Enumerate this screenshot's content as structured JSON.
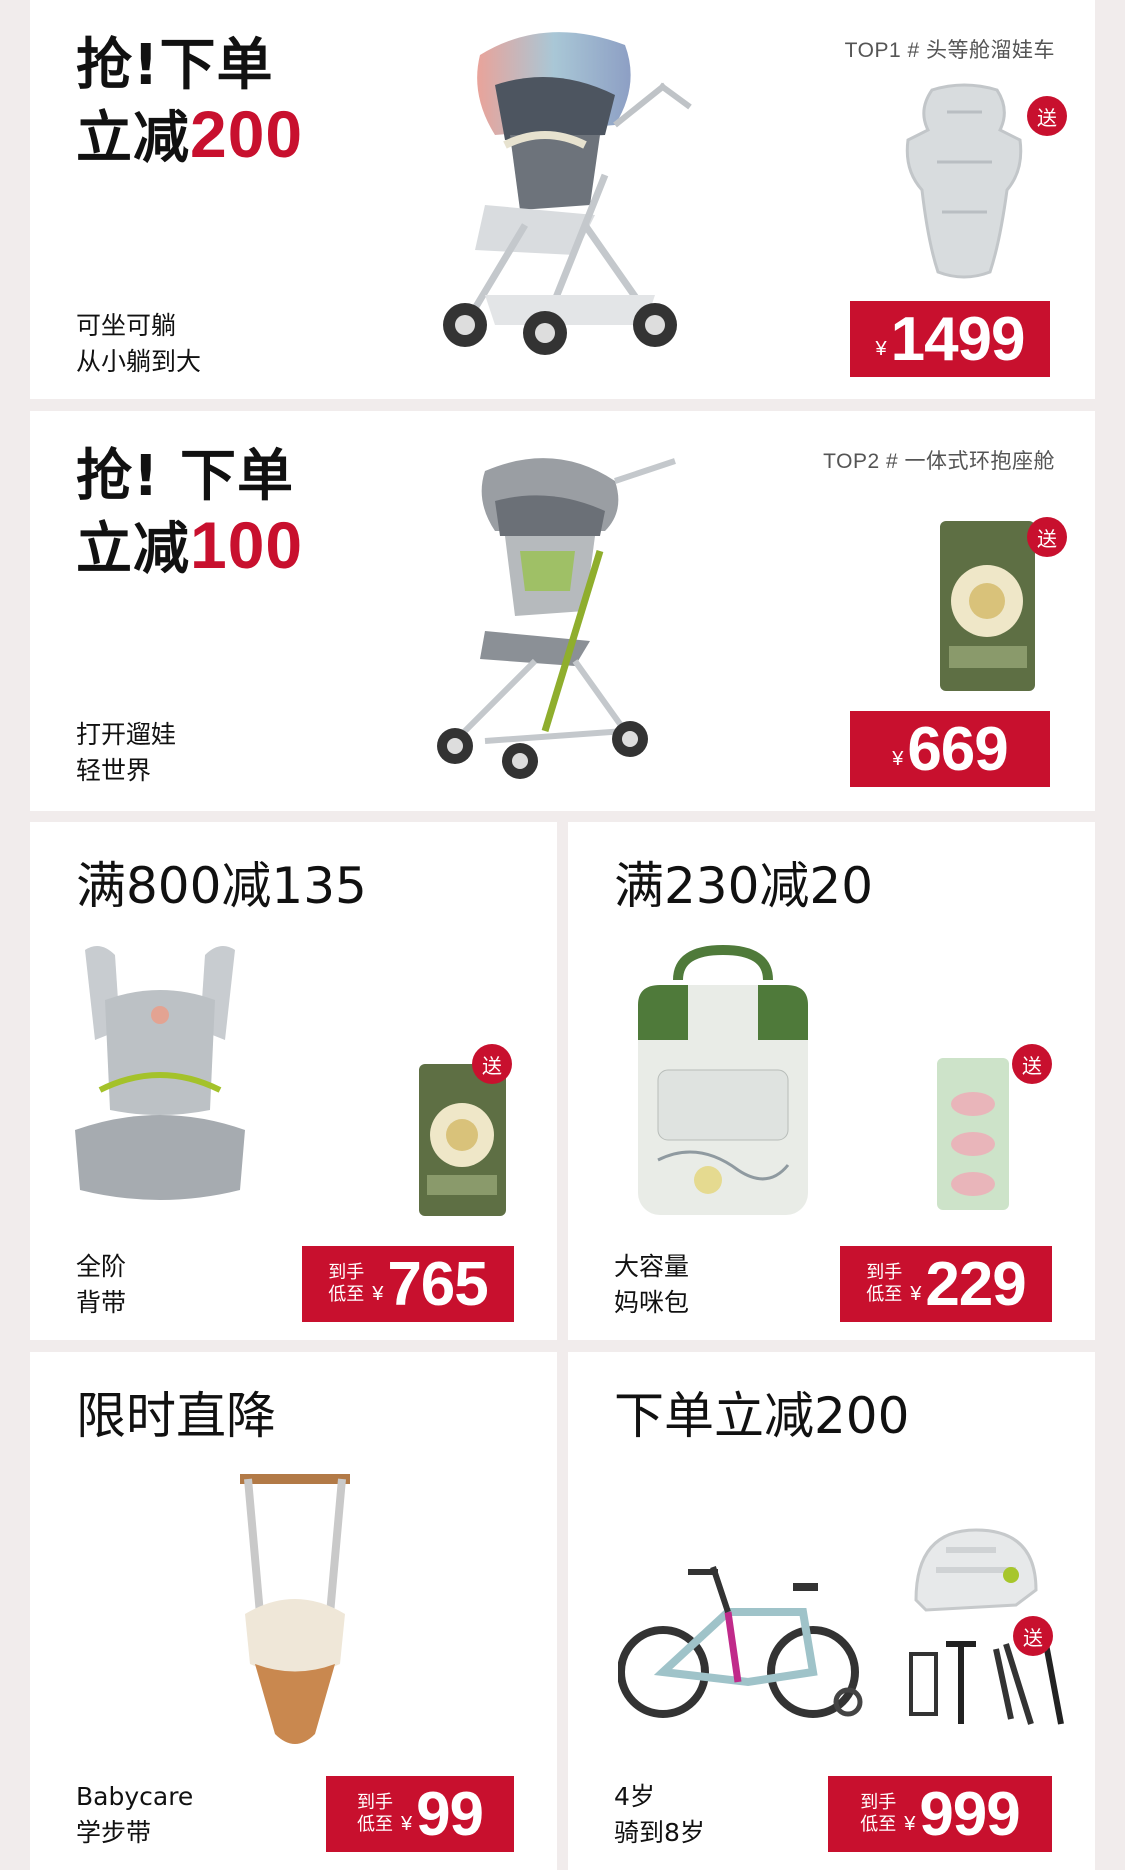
{
  "cards": [
    {
      "headline_line1": "抢!下单",
      "headline_line2_prefix": "立减",
      "headline_line2_highlight": "200",
      "tag": "TOP1 # 头等舱溜娃车",
      "desc_line1": "可坐可躺",
      "desc_line2": "从小躺到大",
      "gift_label": "送",
      "price_currency": "¥",
      "price": "1499"
    },
    {
      "headline_line1": "抢! 下单",
      "headline_line2_prefix": "立减",
      "headline_line2_highlight": "100",
      "tag": "TOP2 # 一体式环抱座舱",
      "desc_line1": "打开遛娃",
      "desc_line2": "轻世界",
      "gift_label": "送",
      "price_currency": "¥",
      "price": "669"
    },
    {
      "title": "满800减135",
      "desc_line1": "全阶",
      "desc_line2": "背带",
      "gift_label": "送",
      "price_prefix_line1": "到手",
      "price_prefix_line2": "低至",
      "price_currency": "¥",
      "price": "765"
    },
    {
      "title": "满230减20",
      "desc_line1": "大容量",
      "desc_line2": "妈咪包",
      "gift_label": "送",
      "price_prefix_line1": "到手",
      "price_prefix_line2": "低至",
      "price_currency": "¥",
      "price": "229"
    },
    {
      "title": "限时直降",
      "desc_line1": "Babycare",
      "desc_line2": "学步带",
      "price_prefix_line1": "到手",
      "price_prefix_line2": "低至",
      "price_currency": "¥",
      "price": "99"
    },
    {
      "title": "下单立减200",
      "desc_line1": "4岁",
      "desc_line2": "骑到8岁",
      "gift_label": "送",
      "price_prefix_line1": "到手",
      "price_prefix_line2": "低至",
      "price_currency": "¥",
      "price": "999"
    }
  ],
  "colors": {
    "accent": "#c8102e",
    "page_bg": "#f1ecec",
    "card_bg": "#ffffff"
  },
  "icons": [
    "stroller-image",
    "seat-liner-image",
    "light-stroller-image",
    "diaper-pack-image",
    "baby-carrier-image",
    "diaper-bag-image",
    "wipes-pack-image",
    "walking-harness-image",
    "kids-bike-image",
    "helmet-image",
    "bike-accessories-image"
  ]
}
